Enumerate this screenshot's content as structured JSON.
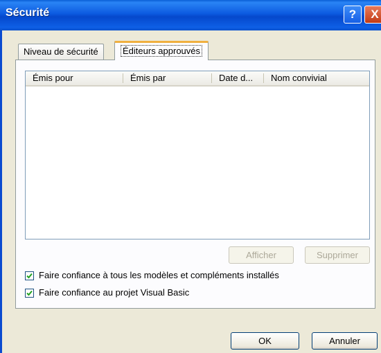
{
  "window": {
    "title": "Sécurité"
  },
  "titlebar": {
    "help_glyph": "?",
    "close_glyph": "X"
  },
  "tabs": [
    {
      "label": "Niveau de sécurité",
      "selected": false
    },
    {
      "label": "Éditeurs approuvés",
      "selected": true
    }
  ],
  "list": {
    "columns": [
      "Émis pour",
      "Émis par",
      "Date d...",
      "Nom convivial"
    ],
    "rows": []
  },
  "buttons": {
    "show": "Afficher",
    "delete": "Supprimer",
    "ok": "OK",
    "cancel": "Annuler"
  },
  "checkboxes": [
    {
      "label": "Faire confiance à tous les modèles et compléments installés",
      "checked": true
    },
    {
      "label": "Faire confiance au projet Visual Basic",
      "checked": true
    }
  ],
  "colors": {
    "title_blue": "#0548cc",
    "check_green": "#21a121",
    "tab_accent": "#f0b040"
  }
}
